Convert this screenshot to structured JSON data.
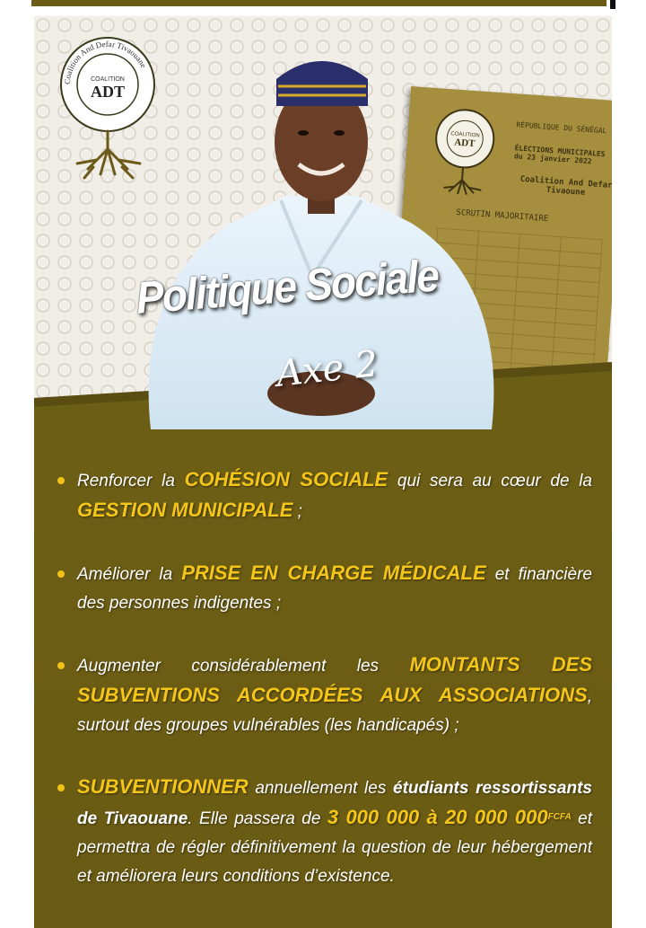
{
  "logo": {
    "arc_text": "Coalition And Defar Tivaouane",
    "small": "COALITION",
    "big": "ADT"
  },
  "ballot": {
    "header": "RÉPUBLIQUE DU SÉNÉGAL",
    "elections": "ÉLECTIONS MUNICIPALES du 23 janvier 2022",
    "coalition": "Coalition And Defar Tivaoune",
    "scrutin": "SCRUTIN MAJORITAIRE"
  },
  "title": "Politique Sociale",
  "axe": "Axe 2",
  "items": [
    {
      "t1": "Renforcer la ",
      "h1": "COHÉSION SOCIALE",
      "t2": " qui sera au cœur de la ",
      "h2": "GESTION MUNICIPALE",
      "t3": " ;"
    },
    {
      "t1": "Améliorer la ",
      "h1": "PRISE EN CHARGE MÉDICALE",
      "t2": " et financière des personnes indigentes ;"
    },
    {
      "t1": "Augmenter considérablement les ",
      "h1": "MONTANTS DES SUBVENTIONS ACCORDÉES AUX ASSOCIATIONS",
      "t2": ", surtout des groupes vulnérables (les handicapés) ;"
    },
    {
      "h1": "SUBVENTIONNER",
      "t1": " annuellement les ",
      "b1": "étudiants ressortissants de Tivaouane",
      "t2": ". Elle passera de ",
      "h2": "3 000 000",
      "h3": " à ",
      "h4": "20 000 000",
      "sup": "FCFA",
      "t3": " et permettra de régler définitivement la question de leur hébergement et améliorera leurs conditions d’existence."
    }
  ],
  "colors": {
    "olive": "#6e5f16",
    "gold": "#f5c61a"
  }
}
